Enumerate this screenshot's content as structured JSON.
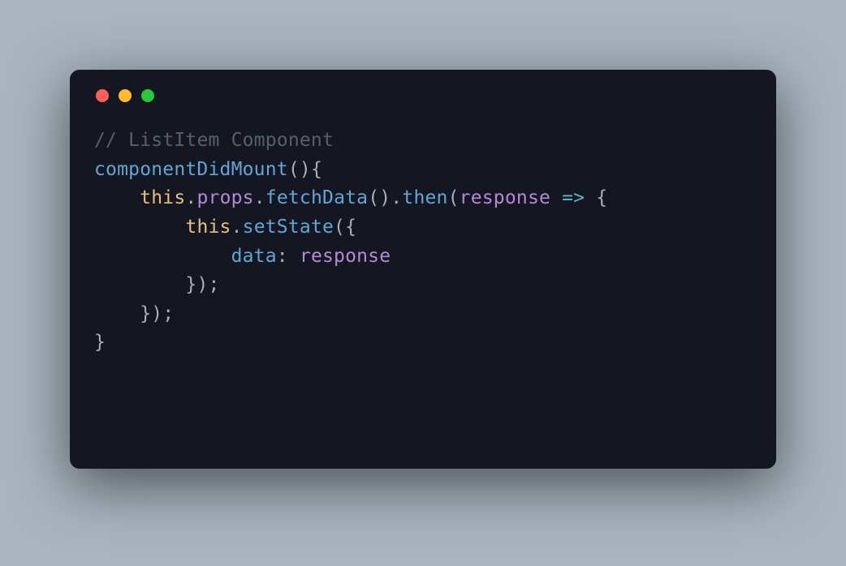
{
  "window": {
    "traffic_lights": [
      "red",
      "yellow",
      "green"
    ]
  },
  "code": {
    "comment_prefix": "// ",
    "comment_text": "ListItem Component",
    "kw_this": "this",
    "id_componentDidMount": "componentDidMount",
    "id_props": "props",
    "id_fetchData": "fetchData",
    "id_then": "then",
    "id_response": "response",
    "id_setState": "setState",
    "id_data": "data",
    "p_open_paren": "(",
    "p_close_paren": ")",
    "p_open_brace": "{",
    "p_close_brace": "}",
    "p_dot": ".",
    "p_colon_sp": ": ",
    "p_semicolon": ";",
    "p_arrow": "=>",
    "p_empty_parens": "()",
    "p_close_brace_paren_semi": "});",
    "sp1": " ",
    "indent1": "    ",
    "indent2": "        ",
    "indent3": "            "
  }
}
